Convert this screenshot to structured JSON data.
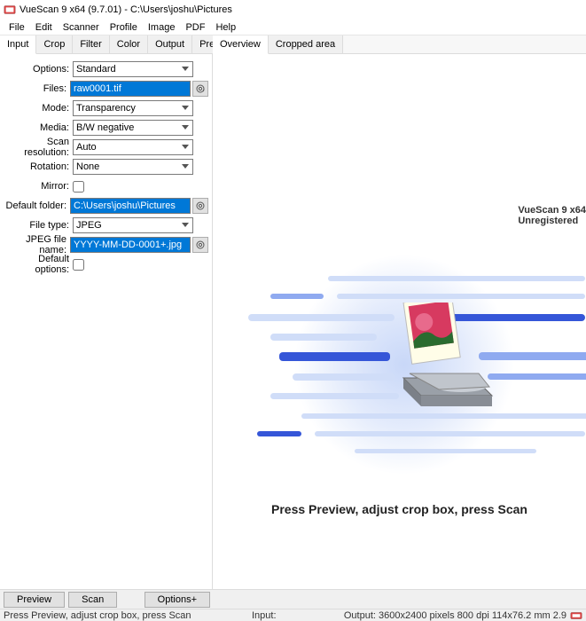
{
  "titlebar": {
    "text": "VueScan 9 x64 (9.7.01) - C:\\Users\\joshu\\Pictures"
  },
  "menubar": [
    "File",
    "Edit",
    "Scanner",
    "Profile",
    "Image",
    "PDF",
    "Help"
  ],
  "leftTabs": [
    "Input",
    "Crop",
    "Filter",
    "Color",
    "Output",
    "Prefs"
  ],
  "activeLeftTab": 0,
  "form": {
    "options": {
      "label": "Options:",
      "value": "Standard"
    },
    "files": {
      "label": "Files:",
      "value": "raw0001.tif"
    },
    "mode": {
      "label": "Mode:",
      "value": "Transparency"
    },
    "media": {
      "label": "Media:",
      "value": "B/W negative"
    },
    "scanres": {
      "label": "Scan resolution:",
      "value": "Auto"
    },
    "rotation": {
      "label": "Rotation:",
      "value": "None"
    },
    "mirror": {
      "label": "Mirror:"
    },
    "defaultfolder": {
      "label": "Default folder:",
      "value": "C:\\Users\\joshu\\Pictures"
    },
    "filetype": {
      "label": "File type:",
      "value": "JPEG"
    },
    "jpegname": {
      "label": "JPEG file name:",
      "value": "YYYY-MM-DD-0001+.jpg"
    },
    "defaultoptions": {
      "label": "Default options:"
    }
  },
  "rightTabs": [
    "Overview",
    "Cropped area"
  ],
  "activeRightTab": 0,
  "watermark": {
    "line1": "VueScan 9 x64",
    "line2": "Unregistered"
  },
  "instruction": "Press Preview, adjust crop box, press Scan",
  "buttons": {
    "preview": "Preview",
    "scan": "Scan",
    "options": "Options+"
  },
  "statusbar": {
    "left": "Press Preview, adjust crop box, press Scan",
    "mid": "Input:",
    "right": "Output: 3600x2400 pixels 800 dpi 114x76.2 mm 2.9"
  }
}
